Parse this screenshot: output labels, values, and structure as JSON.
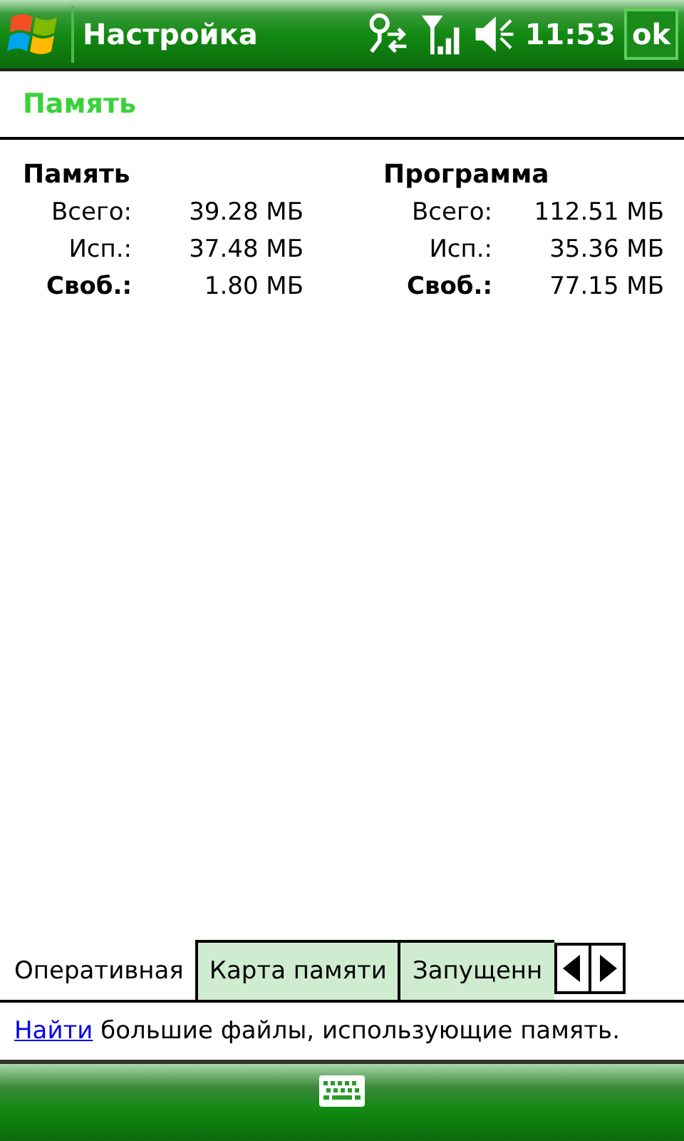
{
  "title_bar": {
    "title": "Настройка",
    "time": "11:53",
    "ok_button": "ok"
  },
  "page_header": "Память",
  "sections": [
    {
      "heading": "Память",
      "rows": [
        {
          "label": "Всего:",
          "value": "39.28 МБ",
          "bold": false
        },
        {
          "label": "Исп.:",
          "value": "37.48 МБ",
          "bold": false
        },
        {
          "label": "Своб.:",
          "value": "1.80 МБ",
          "bold": true
        }
      ]
    },
    {
      "heading": "Программа",
      "rows": [
        {
          "label": "Всего:",
          "value": "112.51 МБ",
          "bold": false
        },
        {
          "label": "Исп.:",
          "value": "35.36 МБ",
          "bold": false
        },
        {
          "label": "Своб.:",
          "value": "77.15 МБ",
          "bold": true
        }
      ]
    }
  ],
  "tabs": [
    {
      "label": "Оперативная",
      "selected": true
    },
    {
      "label": "Карта памяти",
      "selected": false
    },
    {
      "label": "Запущенн",
      "selected": false
    }
  ],
  "footer_note": {
    "link": "Найти",
    "text": "большие файлы, использующие память."
  }
}
